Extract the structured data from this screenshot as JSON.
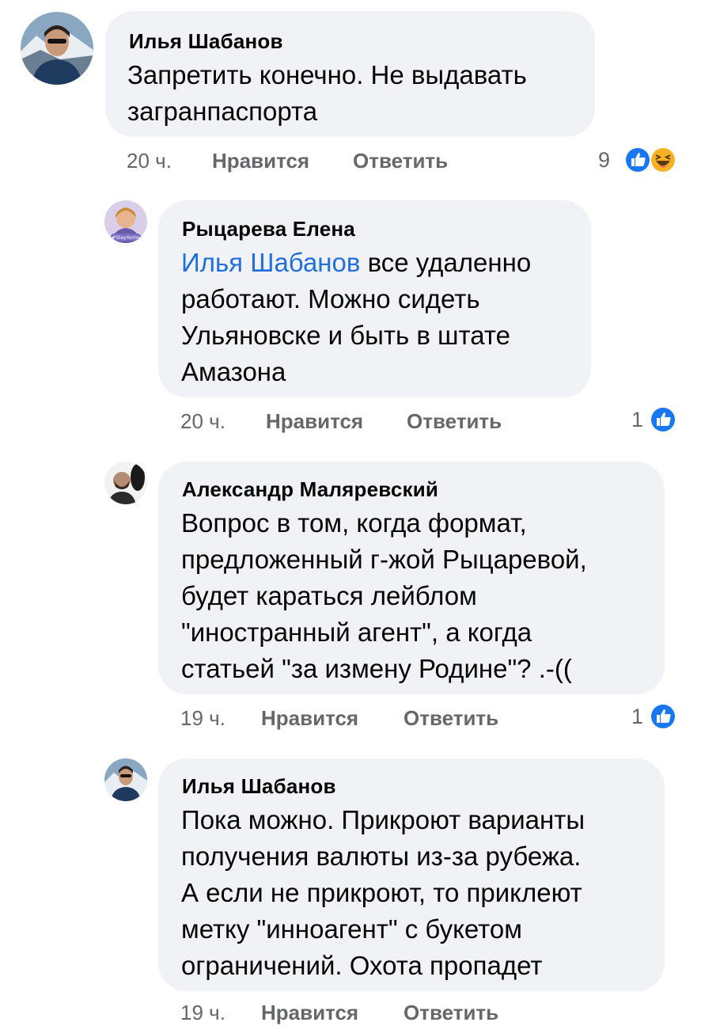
{
  "comments": [
    {
      "author": "Илья Шабанов",
      "text": "Запретить конечно. Не выдавать\nзагранпаспорта",
      "time": "20 ч.",
      "like_label": "Нравится",
      "reply_label": "Ответить",
      "reaction_count": "9",
      "reactions": [
        "like-icon",
        "haha-icon"
      ]
    },
    {
      "author": "Рыцарева Елена",
      "mention": "Илья Шабанов",
      "text": " все удаленно\nработают. Можно сидеть\nУльяновске и быть в штате\nАмазона",
      "time": "20 ч.",
      "like_label": "Нравится",
      "reply_label": "Ответить",
      "reaction_count": "1",
      "reactions": [
        "like-icon"
      ],
      "avatar_badge": "#StayHome"
    },
    {
      "author": "Александр Маляревский",
      "text": "Вопрос в том, когда формат,\nпредложенный г-жой Рыцаревой,\nбудет караться лейблом\n\"иностранный агент\", а когда\nстатьей \"за измену Родине\"? .-((",
      "time": "19 ч.",
      "like_label": "Нравится",
      "reply_label": "Ответить",
      "reaction_count": "1",
      "reactions": [
        "like-icon"
      ]
    },
    {
      "author": "Илья Шабанов",
      "text": "Пока можно. Прикроют варианты\nполучения валюты из-за рубежа.\nА если не прикроют, то приклеют\nметку \"инноагент\" с букетом\nограничений. Охота пропадет",
      "time": "19 ч.",
      "like_label": "Нравится",
      "reply_label": "Ответить"
    }
  ],
  "colors": {
    "bubble": "#f0f2f5",
    "meta": "#65676b",
    "mention": "#216fdb",
    "like_blue": "#1877f2",
    "haha_yellow": "#f7b125"
  }
}
